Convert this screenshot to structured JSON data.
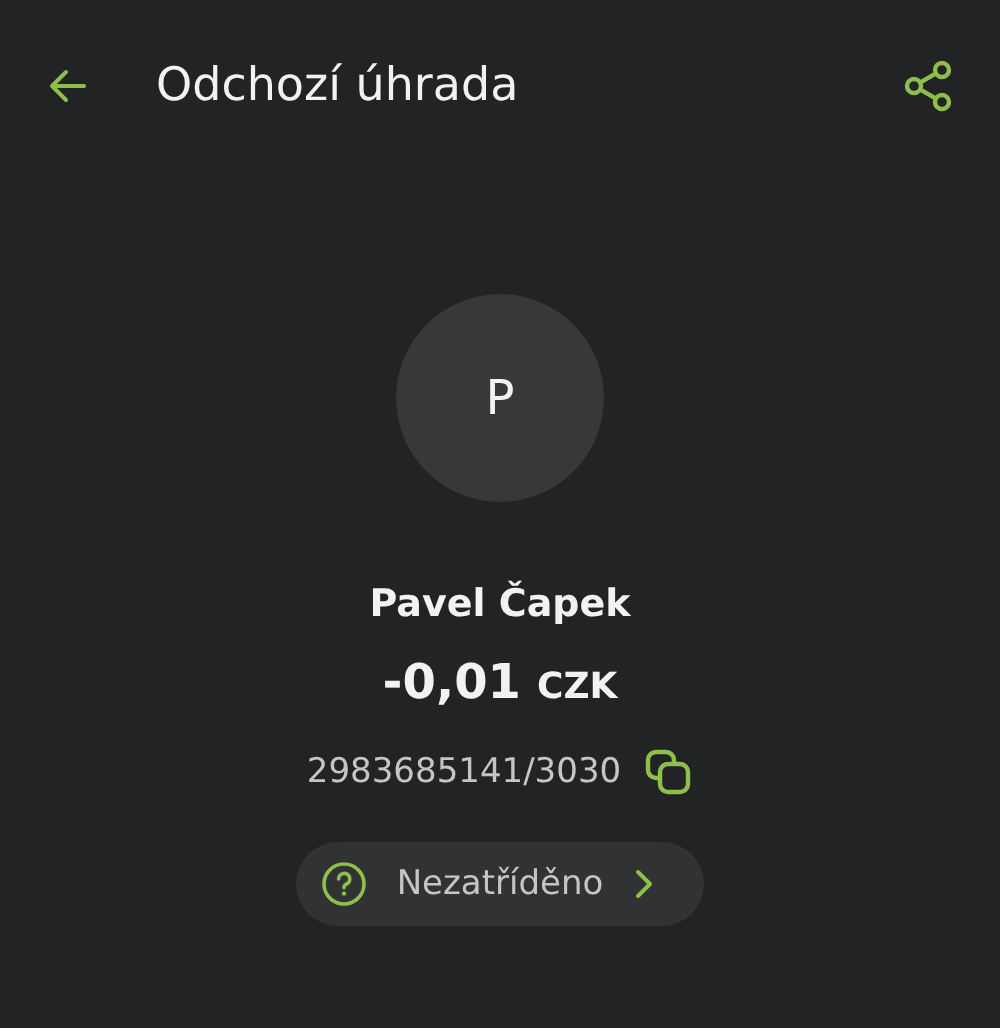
{
  "header": {
    "title": "Odchozí úhrada"
  },
  "avatar": {
    "initial": "P"
  },
  "payee": {
    "name": "Pavel Čapek"
  },
  "amount": {
    "value": "-0,01",
    "currency": "CZK"
  },
  "account": {
    "number": "2983685141/3030"
  },
  "category": {
    "label": "Nezatříděno"
  }
}
